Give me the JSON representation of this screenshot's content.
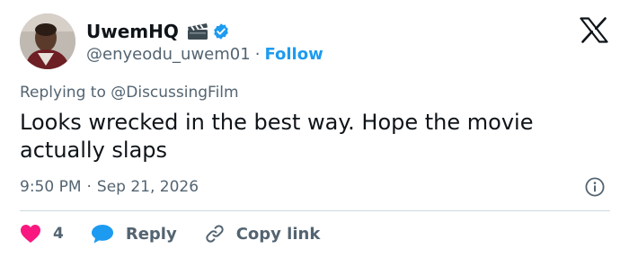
{
  "author": {
    "name": "UwemHQ",
    "handle": "@enyeodu_uwem01",
    "separator": "·",
    "follow_label": "Follow"
  },
  "icons": {
    "avatar": "avatar",
    "clapper": "clapperboard-icon",
    "verified": "verified-badge-icon",
    "brand": "x-logo-icon",
    "info": "info-icon",
    "like": "heart-icon",
    "reply": "speech-bubble-icon",
    "copy": "link-icon"
  },
  "tweet": {
    "replying_prefix": "Replying to ",
    "replying_to": "@DiscussingFilm",
    "text": "Looks wrecked in the best way. Hope the movie actually slaps",
    "time": "9:50 PM",
    "meta_separator": "·",
    "date": "Sep 21, 2026"
  },
  "actions": {
    "like_count": "4",
    "reply_label": "Reply",
    "copy_label": "Copy link"
  },
  "colors": {
    "link": "#1d9bf0",
    "like": "#f91880",
    "muted": "#536471",
    "text": "#0f1419",
    "divider": "#cfd9de"
  }
}
